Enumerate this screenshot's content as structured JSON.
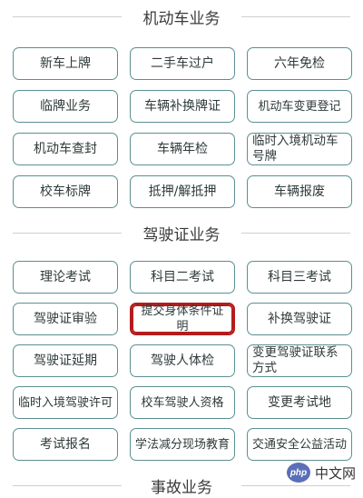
{
  "sections": {
    "vehicle": {
      "title": "机动车业务",
      "items": [
        "新车上牌",
        "二手车过户",
        "六年免检",
        "临牌业务",
        "车辆补换牌证",
        "机动车变更登记",
        "机动车查封",
        "车辆年检",
        "临时入境机动车号牌",
        "校车标牌",
        "抵押/解抵押",
        "车辆报废"
      ]
    },
    "license": {
      "title": "驾驶证业务",
      "items": [
        "理论考试",
        "科目二考试",
        "科目三考试",
        "驾驶证审验",
        "提交身体条件证明",
        "补换驾驶证",
        "驾驶证延期",
        "驾驶人体检",
        "变更驾驶证联系方式",
        "临时入境驾驶许可",
        "校车驾驶人资格",
        "变更考试地",
        "考试报名",
        "学法减分现场教育",
        "交通安全公益活动"
      ]
    },
    "accident": {
      "title": "事故业务"
    }
  },
  "highlight_color": "#b41c1c",
  "watermark": {
    "logo": "php",
    "text": "中文网"
  }
}
